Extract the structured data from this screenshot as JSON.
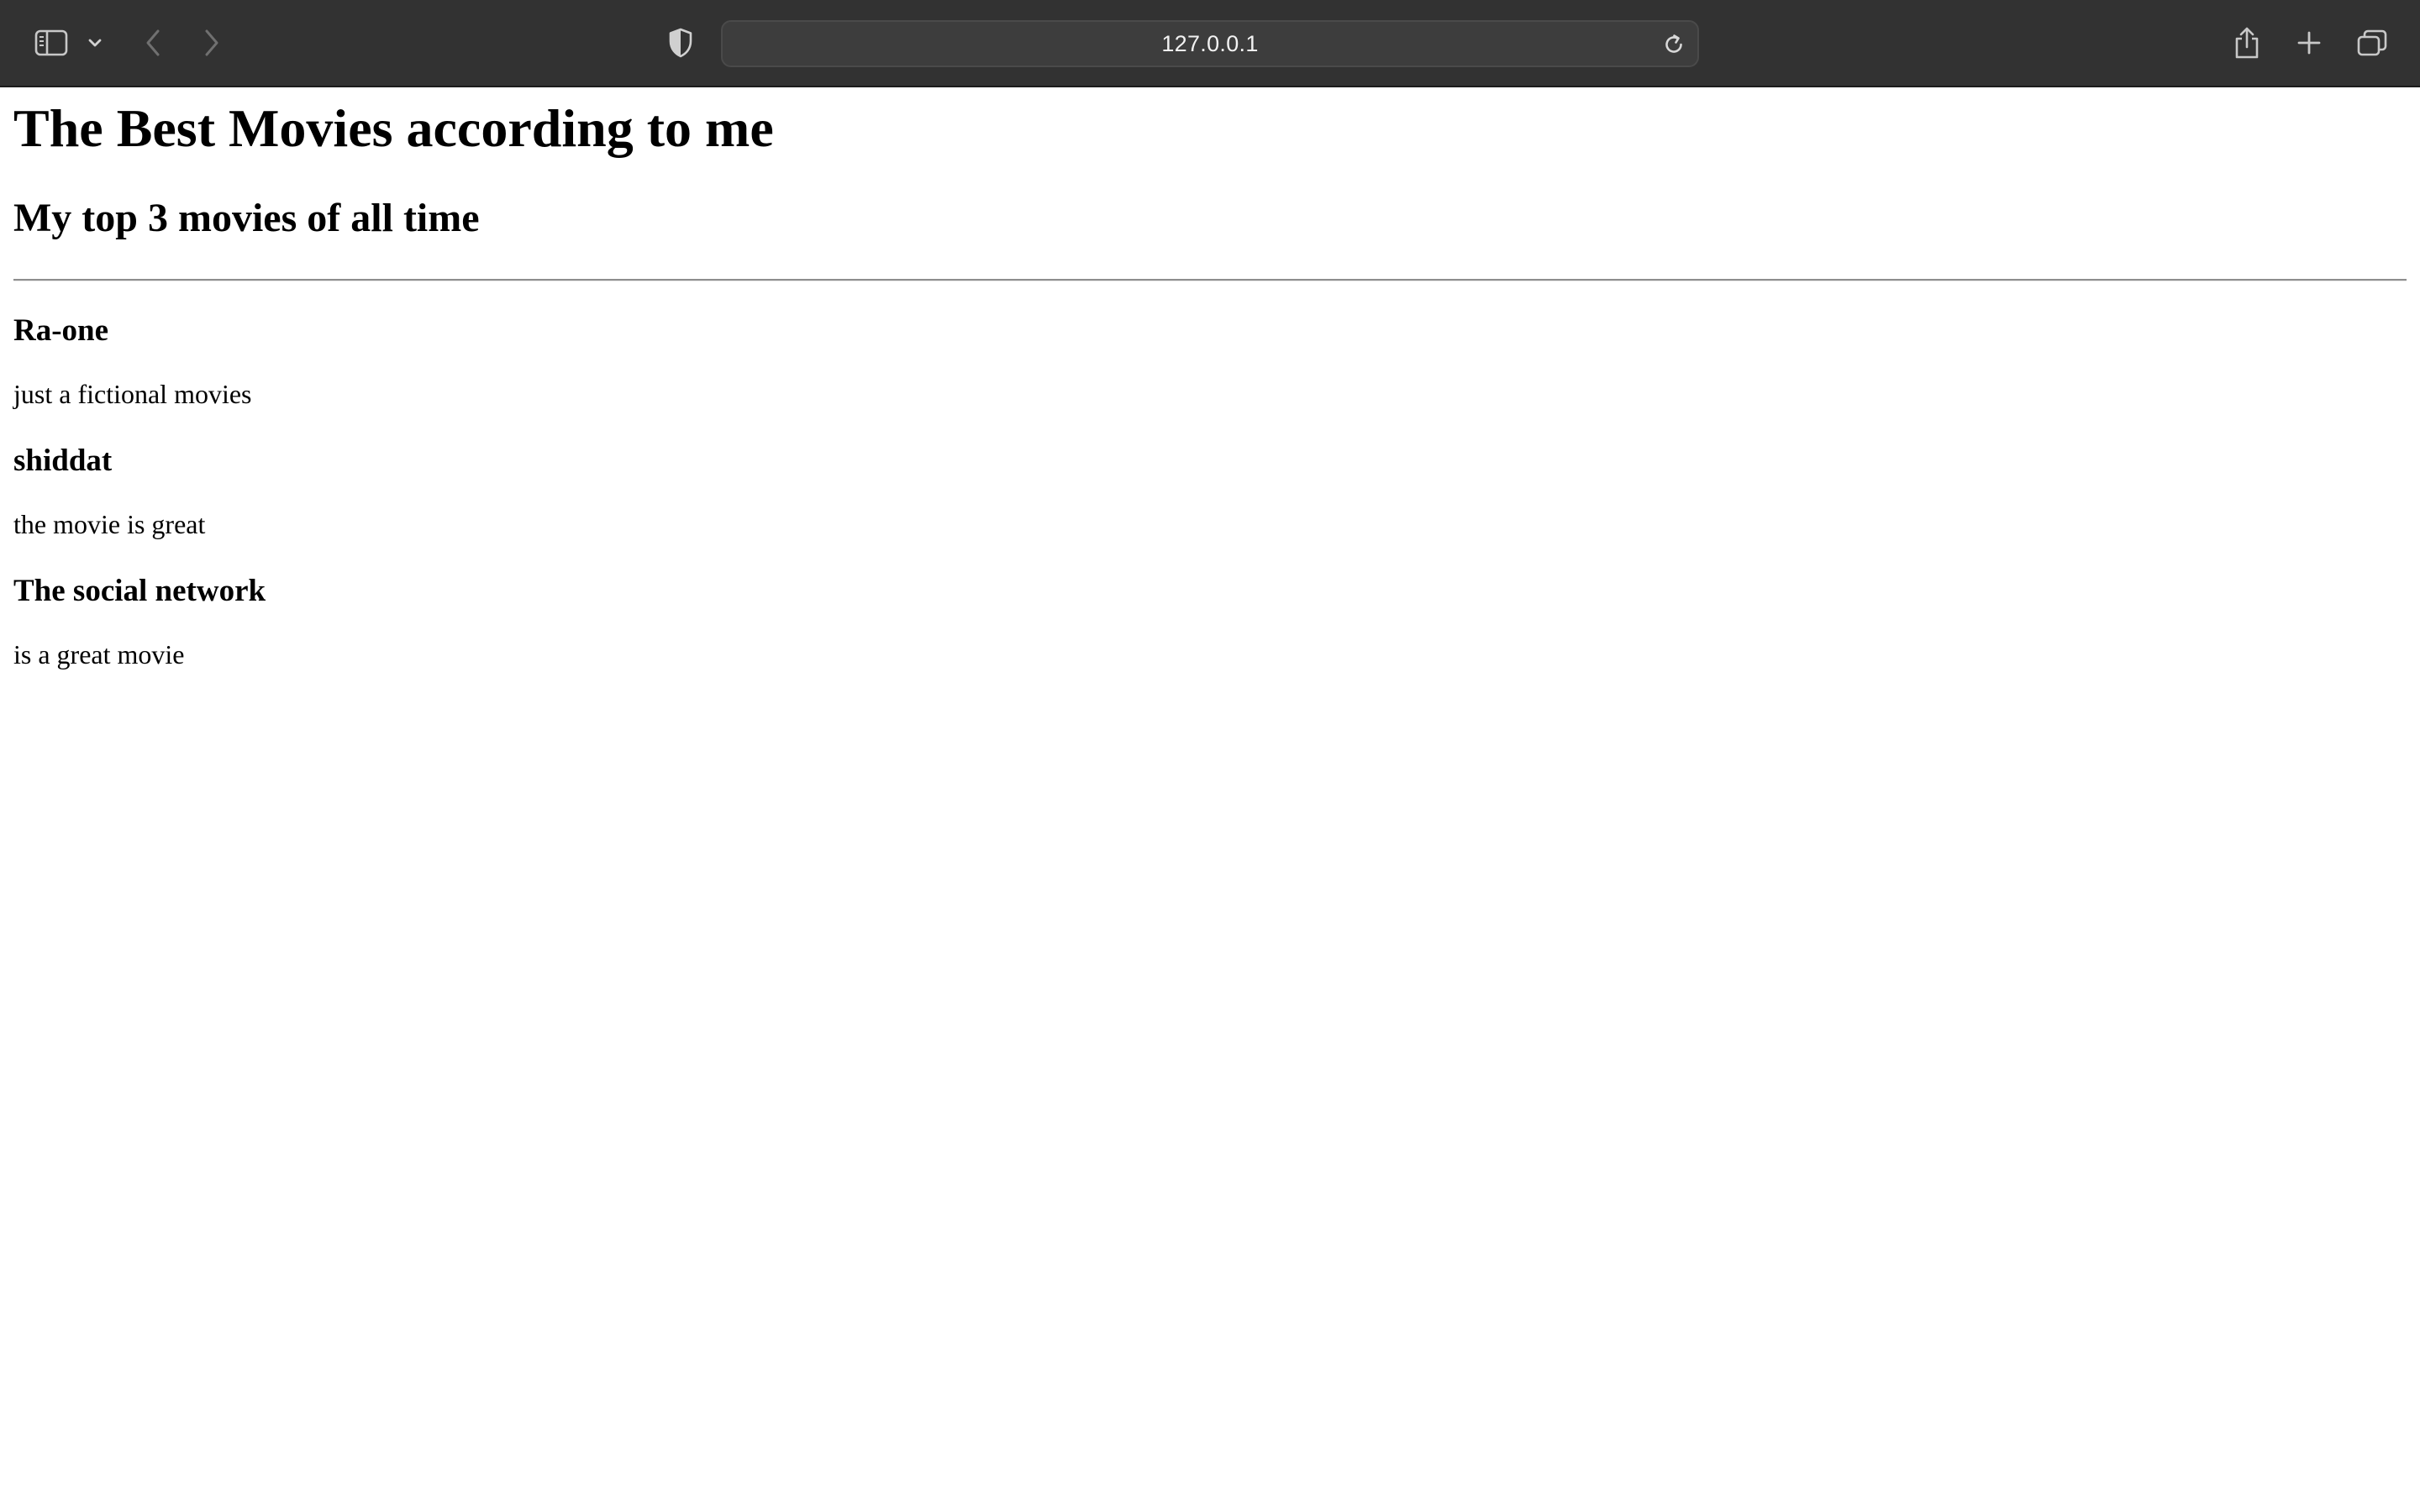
{
  "browser": {
    "url": "127.0.0.1",
    "toolbar_bg": "#323232",
    "icons": {
      "sidebar": "sidebar-icon",
      "sidebar_menu": "chevron-down-icon",
      "back": "back-icon",
      "forward": "forward-icon",
      "privacy": "shield-icon",
      "reload": "reload-icon",
      "share": "share-icon",
      "new_tab": "plus-icon",
      "tab_overview": "tabs-icon"
    }
  },
  "page": {
    "title": "The Best Movies according to me",
    "subtitle": "My top 3 movies of all time",
    "movies": [
      {
        "title": "Ra-one",
        "description": "just a fictional movies"
      },
      {
        "title": "shiddat",
        "description": "the movie is great"
      },
      {
        "title": "The social network",
        "description": "is a great movie"
      }
    ]
  }
}
